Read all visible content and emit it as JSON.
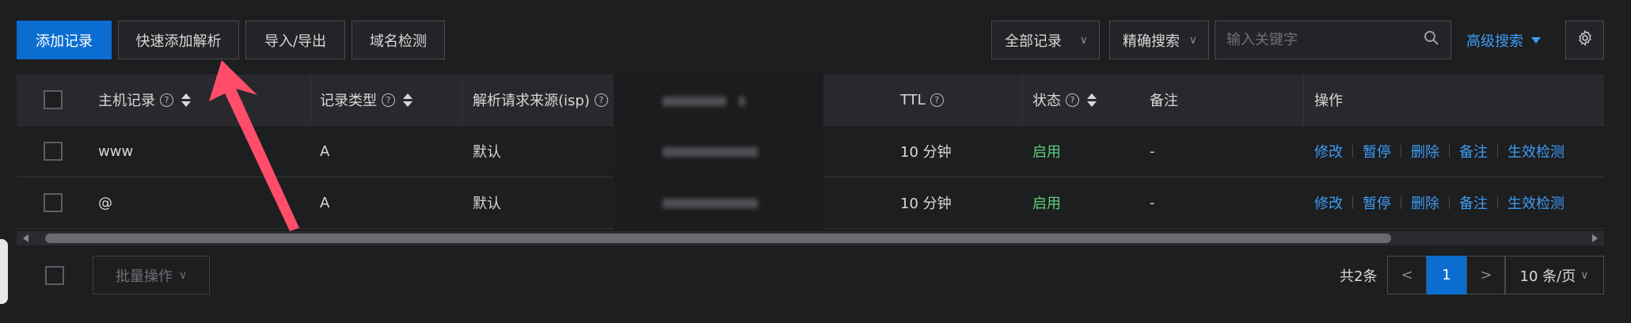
{
  "toolbar": {
    "add_record": "添加记录",
    "quick_add": "快速添加解析",
    "import_export": "导入/导出",
    "domain_check": "域名检测"
  },
  "filters": {
    "record_filter": "全部记录",
    "search_mode": "精确搜索",
    "search_placeholder": "输入关键字",
    "advanced": "高级搜索"
  },
  "table": {
    "headers": {
      "host": "主机记录",
      "type": "记录类型",
      "isp": "解析请求来源(isp)",
      "ttl": "TTL",
      "status": "状态",
      "remark": "备注",
      "actions": "操作"
    },
    "rows": [
      {
        "host": "www",
        "type": "A",
        "isp": "默认",
        "ttl": "10 分钟",
        "status": "启用",
        "remark": "-"
      },
      {
        "host": "@",
        "type": "A",
        "isp": "默认",
        "ttl": "10 分钟",
        "status": "启用",
        "remark": "-"
      }
    ],
    "actions": {
      "edit": "修改",
      "pause": "暂停",
      "delete": "删除",
      "note": "备注",
      "check": "生效检测"
    }
  },
  "footer": {
    "batch": "批量操作",
    "total": "共2条",
    "current_page": "1",
    "page_size": "10 条/页"
  },
  "colors": {
    "primary": "#0c6dd1",
    "link": "#3d9cf5",
    "status_on": "#5fd07a",
    "annotation_arrow": "#ff4d6a"
  }
}
